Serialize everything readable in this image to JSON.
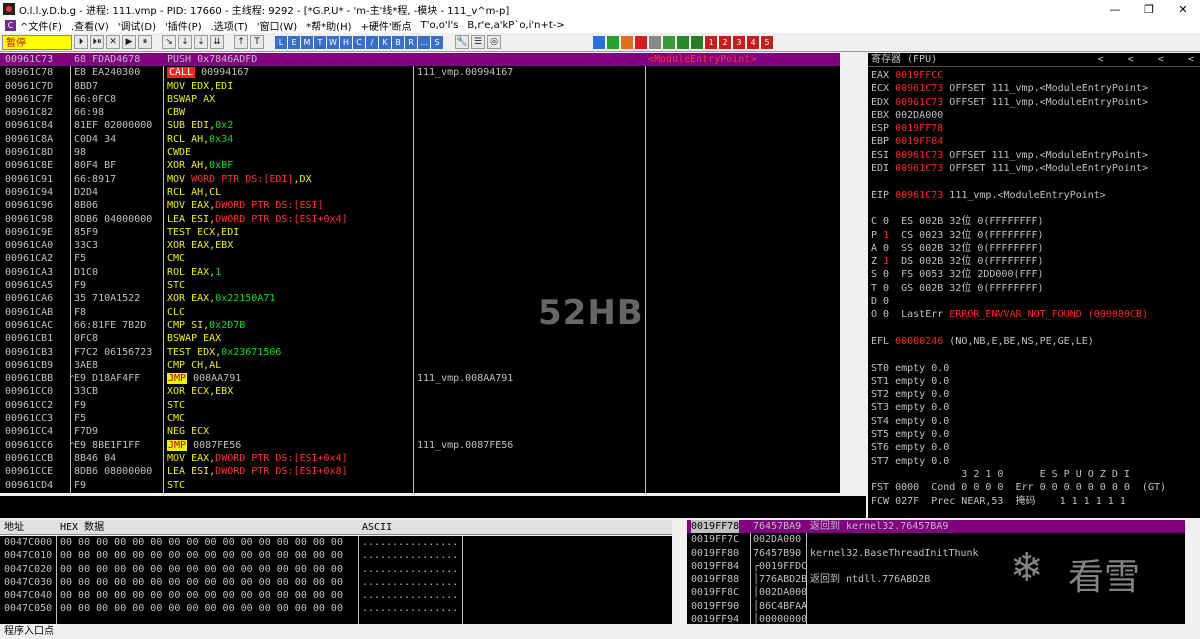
{
  "window": {
    "title": "O.l.l.y.D.b.g - 进程: 111.vmp - PID: 17660 - 主线程: 9292 - [*G.P.U* - 'm-主'线*程, -模块 - 111_v^m-p]",
    "min": "—",
    "max": "❐",
    "close": "✕"
  },
  "menu": [
    "^文件(F)",
    ".查看(V)",
    "'调试(D)",
    "'插件(P)",
    ".选项(T)",
    "'窗口(W)",
    "*帮*助(H)",
    "+硬件'断点",
    "T'o,o'l's",
    "B,r'e,a'kP`o,i'n+t->"
  ],
  "toolbar": {
    "status": "暂停",
    "letters": [
      "L",
      "E",
      "M",
      "T",
      "W",
      "H",
      "C",
      "/",
      "K",
      "B",
      "R",
      "...",
      "S"
    ],
    "nums": [
      "1",
      "2",
      "3",
      "4",
      "5"
    ]
  },
  "disasm": [
    {
      "addr": "00961C73",
      "hex": "68 FDAD4678",
      "asm": [
        [
          "wh",
          "PUSH 0x7846ADFD"
        ]
      ],
      "cmt": "<ModuleEntryPoint>",
      "sel": true
    },
    {
      "addr": "00961C78",
      "hex": "E8 EA240300",
      "asm": [
        [
          "call",
          "CALL"
        ],
        [
          "wh",
          " 00994167"
        ]
      ],
      "cmt": "111_vmp.00994167"
    },
    {
      "addr": "00961C7D",
      "hex": "8BD7",
      "asm": [
        [
          "kw",
          "MOV EDX,EDI"
        ]
      ]
    },
    {
      "addr": "00961C7F",
      "hex": "66:0FC8",
      "asm": [
        [
          "kw",
          "BSWAP AX"
        ]
      ]
    },
    {
      "addr": "00961C82",
      "hex": "66:98",
      "asm": [
        [
          "kw",
          "CBW"
        ]
      ]
    },
    {
      "addr": "00961C84",
      "hex": "81EF 02000000",
      "asm": [
        [
          "kw",
          "SUB EDI,"
        ],
        [
          "sp",
          "0x2"
        ]
      ]
    },
    {
      "addr": "00961C8A",
      "hex": "C0D4 34",
      "asm": [
        [
          "kw",
          "RCL AH,"
        ],
        [
          "sp",
          "0x34"
        ]
      ]
    },
    {
      "addr": "00961C8D",
      "hex": "98",
      "asm": [
        [
          "kw",
          "CWDE"
        ]
      ]
    },
    {
      "addr": "00961C8E",
      "hex": "80F4 BF",
      "asm": [
        [
          "kw",
          "XOR AH,"
        ],
        [
          "sp",
          "0xBF"
        ]
      ]
    },
    {
      "addr": "00961C91",
      "hex": "66:8917",
      "asm": [
        [
          "kw",
          "MOV "
        ],
        [
          "ar",
          "WORD PTR DS:[EDI]"
        ],
        [
          "kw",
          ",DX"
        ]
      ]
    },
    {
      "addr": "00961C94",
      "hex": "D2D4",
      "asm": [
        [
          "kw",
          "RCL AH,CL"
        ]
      ]
    },
    {
      "addr": "00961C96",
      "hex": "8B06",
      "asm": [
        [
          "kw",
          "MOV EAX,"
        ],
        [
          "ar",
          "DWORD PTR DS:[ESI]"
        ]
      ]
    },
    {
      "addr": "00961C98",
      "hex": "8DB6 04000000",
      "asm": [
        [
          "kw",
          "LEA ESI,"
        ],
        [
          "ar",
          "DWORD PTR DS:[ESI+0x4]"
        ]
      ]
    },
    {
      "addr": "00961C9E",
      "hex": "85F9",
      "asm": [
        [
          "kw",
          "TEST ECX,EDI"
        ]
      ]
    },
    {
      "addr": "00961CA0",
      "hex": "33C3",
      "asm": [
        [
          "kw",
          "XOR EAX,EBX"
        ]
      ]
    },
    {
      "addr": "00961CA2",
      "hex": "F5",
      "asm": [
        [
          "kw",
          "CMC"
        ]
      ]
    },
    {
      "addr": "00961CA3",
      "hex": "D1C0",
      "asm": [
        [
          "kw",
          "ROL EAX,"
        ],
        [
          "sp",
          "1"
        ]
      ]
    },
    {
      "addr": "00961CA5",
      "hex": "F9",
      "asm": [
        [
          "kw",
          "STC"
        ]
      ]
    },
    {
      "addr": "00961CA6",
      "hex": "35 710A1522",
      "asm": [
        [
          "kw",
          "XOR EAX,"
        ],
        [
          "sp",
          "0x22150A71"
        ]
      ]
    },
    {
      "addr": "00961CAB",
      "hex": "F8",
      "asm": [
        [
          "kw",
          "CLC"
        ]
      ]
    },
    {
      "addr": "00961CAC",
      "hex": "66:81FE 7B2D",
      "asm": [
        [
          "kw",
          "CMP SI,"
        ],
        [
          "sp",
          "0x2D7B"
        ]
      ]
    },
    {
      "addr": "00961CB1",
      "hex": "0FC8",
      "asm": [
        [
          "kw",
          "BSWAP EAX"
        ]
      ]
    },
    {
      "addr": "00961CB3",
      "hex": "F7C2 06156723",
      "asm": [
        [
          "kw",
          "TEST EDX,"
        ],
        [
          "sp",
          "0x23671506"
        ]
      ]
    },
    {
      "addr": "00961CB9",
      "hex": "3AE8",
      "asm": [
        [
          "kw",
          "CMP CH,AL"
        ]
      ]
    },
    {
      "addr": "00961CBB",
      "hex": "E9 D18AF4FF",
      "asm": [
        [
          "jmp",
          "JMP"
        ],
        [
          "wh",
          " 008AA791"
        ]
      ],
      "cmt": "111_vmp.008AA791",
      "pad": "^"
    },
    {
      "addr": "00961CC0",
      "hex": "33CB",
      "asm": [
        [
          "kw",
          "XOR ECX,EBX"
        ]
      ]
    },
    {
      "addr": "00961CC2",
      "hex": "F9",
      "asm": [
        [
          "kw",
          "STC"
        ]
      ]
    },
    {
      "addr": "00961CC3",
      "hex": "F5",
      "asm": [
        [
          "kw",
          "CMC"
        ]
      ]
    },
    {
      "addr": "00961CC4",
      "hex": "F7D9",
      "asm": [
        [
          "kw",
          "NEG ECX"
        ]
      ]
    },
    {
      "addr": "00961CC6",
      "hex": "E9 8BE1F1FF",
      "asm": [
        [
          "jmp",
          "JMP"
        ],
        [
          "wh",
          " 0087FE56"
        ]
      ],
      "cmt": "111_vmp.0087FE56",
      "pad": "^"
    },
    {
      "addr": "00961CCB",
      "hex": "8B46 04",
      "asm": [
        [
          "kw",
          "MOV EAX,"
        ],
        [
          "ar",
          "DWORD PTR DS:[ESI+0x4]"
        ]
      ]
    },
    {
      "addr": "00961CCE",
      "hex": "8DB6 08000000",
      "asm": [
        [
          "kw",
          "LEA ESI,"
        ],
        [
          "ar",
          "DWORD PTR DS:[ESI+0x8]"
        ]
      ]
    },
    {
      "addr": "00961CD4",
      "hex": "F9",
      "asm": [
        [
          "kw",
          "STC"
        ]
      ]
    },
    {
      "addr": "00961CD5",
      "hex": "F5",
      "asm": [
        [
          "kw",
          "CMC"
        ]
      ]
    }
  ],
  "registers": {
    "title": "寄存器 (FPU)",
    "gp": [
      {
        "n": "EAX",
        "v": "0019FFCC",
        "red": true,
        "d": ""
      },
      {
        "n": "ECX",
        "v": "00961C73",
        "red": true,
        "d": "OFFSET 111_vmp.<ModuleEntryPoint>"
      },
      {
        "n": "EDX",
        "v": "00961C73",
        "red": true,
        "d": "OFFSET 111_vmp.<ModuleEntryPoint>"
      },
      {
        "n": "EBX",
        "v": "002DA000",
        "red": false,
        "d": ""
      },
      {
        "n": "ESP",
        "v": "0019FF78",
        "red": true,
        "d": ""
      },
      {
        "n": "EBP",
        "v": "0019FF84",
        "red": true,
        "d": ""
      },
      {
        "n": "ESI",
        "v": "00961C73",
        "red": true,
        "d": "OFFSET 111_vmp.<ModuleEntryPoint>"
      },
      {
        "n": "EDI",
        "v": "00961C73",
        "red": true,
        "d": "OFFSET 111_vmp.<ModuleEntryPoint>"
      }
    ],
    "eip": {
      "n": "EIP",
      "v": "00961C73",
      "d": "111_vmp.<ModuleEntryPoint>"
    },
    "flags": [
      {
        "f": "C 0",
        "s": "ES 002B 32位 0(FFFFFFFF)",
        "red": false
      },
      {
        "f": "P 1",
        "s": "CS 0023 32位 0(FFFFFFFF)",
        "red": true
      },
      {
        "f": "A 0",
        "s": "SS 002B 32位 0(FFFFFFFF)",
        "red": false
      },
      {
        "f": "Z 1",
        "s": "DS 002B 32位 0(FFFFFFFF)",
        "red": true
      },
      {
        "f": "S 0",
        "s": "FS 0053 32位 2DD000(FFF)",
        "red": false
      },
      {
        "f": "T 0",
        "s": "GS 002B 32位 0(FFFFFFFF)",
        "red": false
      },
      {
        "f": "D 0",
        "s": "",
        "red": false
      }
    ],
    "lasterr": {
      "f": "O 0",
      "label": "LastErr",
      "v": "ERROR_ENVVAR_NOT_FOUND (000000CB)"
    },
    "efl": {
      "label": "EFL",
      "v": "00000246",
      "d": "(NO,NB,E,BE,NS,PE,GE,LE)"
    },
    "fpu": [
      "ST0 empty 0.0",
      "ST1 empty 0.0",
      "ST2 empty 0.0",
      "ST3 empty 0.0",
      "ST4 empty 0.0",
      "ST5 empty 0.0",
      "ST6 empty 0.0",
      "ST7 empty 0.0"
    ],
    "fpuhdr": "               3 2 1 0      E S P U O Z D I",
    "fst": "FST 0000  Cond 0 0 0 0  Err 0 0 0 0 0 0 0 0  (GT)",
    "fcw": "FCW 027F  Prec NEAR,53  掩码    1 1 1 1 1 1"
  },
  "dump": {
    "h_addr": "地址",
    "h_hex": "HEX 数据",
    "h_ascii": "ASCII",
    "rows": [
      {
        "a": "0047C000",
        "h": "00 00 00 00 00 00 00 00 00 00 00 00 00 00 00 00",
        "s": "................"
      },
      {
        "a": "0047C010",
        "h": "00 00 00 00 00 00 00 00 00 00 00 00 00 00 00 00",
        "s": "................"
      },
      {
        "a": "0047C020",
        "h": "00 00 00 00 00 00 00 00 00 00 00 00 00 00 00 00",
        "s": "................"
      },
      {
        "a": "0047C030",
        "h": "00 00 00 00 00 00 00 00 00 00 00 00 00 00 00 00",
        "s": "................"
      },
      {
        "a": "0047C040",
        "h": "00 00 00 00 00 00 00 00 00 00 00 00 00 00 00 00",
        "s": "................"
      },
      {
        "a": "0047C050",
        "h": "00 00 00 00 00 00 00 00 00 00 00 00 00 00 00 00",
        "s": "................"
      }
    ]
  },
  "stack": [
    {
      "a": "0019FF78",
      "v": "76457BA9",
      "c": "返回到 kernel32.76457BA9",
      "sel": true
    },
    {
      "a": "0019FF7C",
      "v": "002DA000",
      "c": ""
    },
    {
      "a": "0019FF80",
      "v": "76457B90",
      "c": "kernel32.BaseThreadInitThunk"
    },
    {
      "a": "0019FF84",
      "v": "┌0019FFDC",
      "c": ""
    },
    {
      "a": "0019FF88",
      "v": "│776ABD2B",
      "c": "返回到 ntdll.776ABD2B"
    },
    {
      "a": "0019FF8C",
      "v": "│002DA000",
      "c": ""
    },
    {
      "a": "0019FF90",
      "v": "│86C4BFAA",
      "c": ""
    },
    {
      "a": "0019FF94",
      "v": "│00000000",
      "c": ""
    }
  ],
  "statusbar": "程序入口点",
  "watermarks": {
    "center": "52HB",
    "brand": "看雪",
    "snow": "❄"
  }
}
